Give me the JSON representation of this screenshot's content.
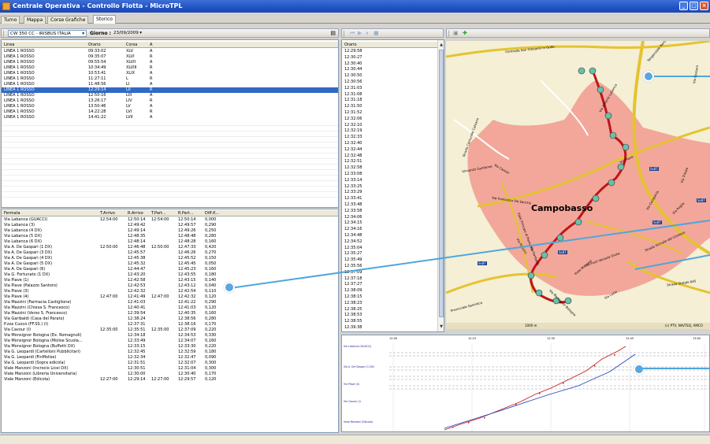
{
  "window": {
    "title": "Centrale Operativa - Controllo Flotta - MicroTPL",
    "min": "_",
    "max": "▢",
    "close": "×"
  },
  "tabs": [
    "Turno",
    "Mappa",
    "Corse Grafiche",
    "Storico"
  ],
  "filters": {
    "vehicle": "CW 350 CC - IRISBUS ITALIA",
    "day_label": "Giorno :",
    "day_value": "23/09/2009"
  },
  "trips": {
    "headers": [
      "Linea",
      "Orario",
      "Corsa",
      "A"
    ],
    "rows": [
      [
        "LINEA 1 ROSSO",
        "09:33:02",
        "XLV",
        "A"
      ],
      [
        "LINEA 1 ROSSO",
        "09:35:07",
        "XLVI",
        "R"
      ],
      [
        "LINEA 1 ROSSO",
        "09:55:54",
        "XLVII",
        "A"
      ],
      [
        "LINEA 1 ROSSO",
        "10:34:49",
        "XLVIII",
        "R"
      ],
      [
        "LINEA 1 ROSSO",
        "10:53:41",
        "XLIX",
        "A"
      ],
      [
        "LINEA 1 ROSSO",
        "11:27:11",
        "L",
        "R"
      ],
      [
        "LINEA 1 ROSSO",
        "11:48:56",
        "LI",
        "A"
      ],
      [
        "LINEA 1 ROSSO",
        "12:29:14",
        "LII",
        "R"
      ],
      [
        "LINEA 1 ROSSO",
        "12:50:16",
        "LIII",
        "A"
      ],
      [
        "LINEA 1 ROSSO",
        "13:26:17",
        "LIV",
        "R"
      ],
      [
        "LINEA 1 ROSSO",
        "13:50:46",
        "LV",
        "A"
      ],
      [
        "LINEA 1 ROSSO",
        "14:22:28",
        "LVI",
        "R"
      ],
      [
        "LINEA 1 ROSSO",
        "14:41:22",
        "LVII",
        "A"
      ]
    ],
    "selected": 7
  },
  "stops": {
    "headers": [
      "Fermata",
      "T.Arrivo",
      "R.Arrivo",
      "T.Part...",
      "R.Part...",
      "Diff.K..."
    ],
    "rows": [
      [
        "Via Labanca (GUACCI)",
        "12:54:00",
        "12:50:14",
        "12:54:00",
        "12:50:14",
        "0,000"
      ],
      [
        "Via Labanca (3)",
        "",
        "12:49:42",
        "",
        "12:49:57",
        "0,290"
      ],
      [
        "Via Labanca (4 DX)",
        "",
        "12:49:14",
        "",
        "12:49:26",
        "0,250"
      ],
      [
        "Via Labanca (5 DX)",
        "",
        "12:48:35",
        "",
        "12:48:48",
        "0,280"
      ],
      [
        "Via Labanca (6 DX)",
        "",
        "12:48:14",
        "",
        "12:48:28",
        "0,160"
      ],
      [
        "Via A. De Gaspari (1 DX)",
        "12:50:00",
        "12:46:48",
        "12:50:00",
        "12:47:33",
        "0,420"
      ],
      [
        "Via A. De Gaspari (3 DX)",
        "",
        "12:45:57",
        "",
        "12:46:26",
        "0,270"
      ],
      [
        "Via A. De Gaspari (4 DX)",
        "",
        "12:45:38",
        "",
        "12:45:52",
        "0,150"
      ],
      [
        "Via A. De Gaspari (5 DX)",
        "",
        "12:45:32",
        "",
        "12:45:45",
        "0,050"
      ],
      [
        "Via A. De Gaspari (6)",
        "",
        "12:44:47",
        "",
        "12:45:23",
        "0,160"
      ],
      [
        "Via G. Fortunato (1 DX)",
        "",
        "12:43:20",
        "",
        "12:43:55",
        "0,180"
      ],
      [
        "Via Piave (1)",
        "",
        "12:42:58",
        "",
        "12:43:15",
        "0,140"
      ],
      [
        "Via Piave (Palazzo Santoro)",
        "",
        "12:42:53",
        "",
        "12:43:12",
        "0,040"
      ],
      [
        "Via Piave (3)",
        "",
        "12:42:32",
        "",
        "12:42:54",
        "0,110"
      ],
      [
        "Via Piave (4)",
        "12:47:00",
        "12:41:49",
        "12:47:00",
        "12:42:32",
        "0,120"
      ],
      [
        "Via Mazzini (Farmacia Castiglione)",
        "",
        "12:41:03",
        "",
        "12:41:22",
        "0,290"
      ],
      [
        "Via Mazzini (Chiesa S. Francesco)",
        "",
        "12:40:41",
        "",
        "12:41:03",
        "0,120"
      ],
      [
        "Via Mazzini (Verso S. Francesco)",
        "",
        "12:39:54",
        "",
        "12:40:35",
        "0,160"
      ],
      [
        "Via Garibaldi (Casa del Parato)",
        "",
        "12:38:24",
        "",
        "12:38:56",
        "0,280"
      ],
      [
        "P.zza Cuoco (FF.SS.) (I)",
        "",
        "12:37:31",
        "",
        "12:38:16",
        "0,170"
      ],
      [
        "Via Cavour (I)",
        "12:35:00",
        "12:35:51",
        "12:35:00",
        "12:37:09",
        "0,220"
      ],
      [
        "Via Monsignor Bologna (Ex. Romagnoli)",
        "",
        "12:34:18",
        "",
        "12:34:53",
        "0,330"
      ],
      [
        "Via Monsignor Bologna (Molise Scuola...",
        "",
        "12:33:49",
        "",
        "12:34:07",
        "0,160"
      ],
      [
        "Via Monsignor Bologna (Buffetti DX)",
        "",
        "12:33:15",
        "",
        "12:33:30",
        "0,220"
      ],
      [
        "Via G. Leopardi (Cartelloni Pubblicitari)",
        "",
        "12:32:45",
        "",
        "12:32:59",
        "0,180"
      ],
      [
        "Via G. Leopardi (FinMolise)",
        "",
        "12:32:34",
        "",
        "12:32:47",
        "0,090"
      ],
      [
        "Via G. Leopardi (Sopra edicola)",
        "",
        "12:31:51",
        "",
        "12:32:07",
        "0,300"
      ],
      [
        "Viale Manzoni (Incrocio Licei DX)",
        "",
        "12:30:51",
        "",
        "12:31:04",
        "0,300"
      ],
      [
        "Viale Manzoni (Libreria Universitaria)",
        "",
        "12:30:00",
        "",
        "12:30:40",
        "0,170"
      ],
      [
        "Viale Manzoni (Edicola)",
        "12:27:00",
        "12:29:14",
        "12:27:00",
        "12:29:57",
        "0,120"
      ]
    ]
  },
  "times": {
    "header": "Orario",
    "rows": [
      "12:29:58",
      "12:30:27",
      "12:30:40",
      "12:30:44",
      "12:30:50",
      "12:30:56",
      "12:31:03",
      "12:31:08",
      "12:31:18",
      "12:31:50",
      "12:31:52",
      "12:32:06",
      "12:32:10",
      "12:32:19",
      "12:32:33",
      "12:32:40",
      "12:32:44",
      "12:32:48",
      "12:32:51",
      "12:32:58",
      "12:33:08",
      "12:33:14",
      "12:33:25",
      "12:33:29",
      "12:33:41",
      "12:33:48",
      "12:33:58",
      "12:34:06",
      "12:34:15",
      "12:34:16",
      "12:34:48",
      "12:34:52",
      "12:35:04",
      "12:35:27",
      "12:35:49",
      "12:35:56",
      "12:37:09",
      "12:37:18",
      "12:37:27",
      "12:38:09",
      "12:38:15",
      "12:38:23",
      "12:38:25",
      "12:38:53",
      "12:38:55",
      "12:39:38"
    ]
  },
  "map": {
    "city": "Campobasso",
    "labels": [
      "Contrada San Giovanni in Golfo",
      "Tangenziale Nord",
      "Via Piave",
      "Via Francesco De Sanctis",
      "Via Cavour",
      "Via Trieste",
      "Via Puglia",
      "Strada Vicinale del Cimitero",
      "Strada Statale 645",
      "Via Lazio",
      "Via Mazzini",
      "Via Monsignor Bologna",
      "Via Antonio Labanca",
      "Via Garibaldi",
      "Viale Manzoni",
      "Viale Principe di Piemonte",
      "Via Campania",
      "Provinciale Sannitica",
      "Strada Comunale Calvario",
      "Via Friuli Venezia Giulia",
      "Via Gazzani",
      "Vincenzo Gambone"
    ],
    "shields": [
      "Ss87",
      "Ss87",
      "Ss87",
      "Ss87",
      "Ss87"
    ],
    "scale": "1000 m",
    "copyright": "(c) PTV, NAVTEQ, AMCO"
  },
  "chart": {
    "x_labels": [
      "12:00",
      "12:15",
      "12:30",
      "12:45",
      "13:00"
    ],
    "legend": [
      "Via Labanca (GUACCI)",
      "Via A. De Gaspari (1 DX)",
      "Via Piave (4)",
      "Via Cavour (I)",
      "Viale Manzoni (Edicola)"
    ]
  },
  "colors": {
    "accent": "#316ac5",
    "route": "#c0141a",
    "marker": "#5aa7e0",
    "urban": "#f2a79a"
  }
}
